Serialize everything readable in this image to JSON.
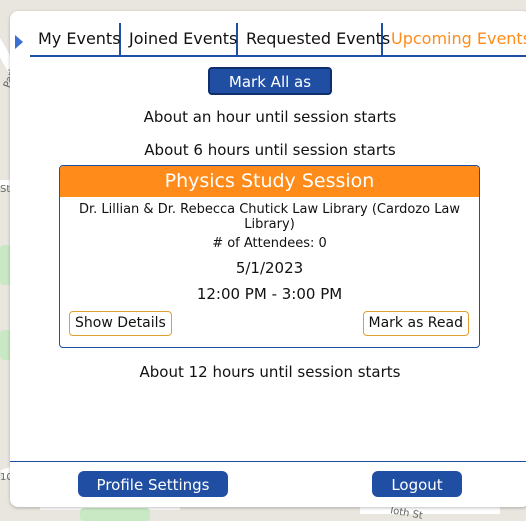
{
  "tabs": [
    {
      "label": "My Events"
    },
    {
      "label": "Joined Events"
    },
    {
      "label": "Requested Events"
    },
    {
      "label": "Upcoming Events"
    }
  ],
  "mark_all_label": "Mark All as Read",
  "notices": [
    "About an hour until session starts",
    "About 6 hours until session starts",
    "About 12 hours until session starts"
  ],
  "event_card": {
    "title": "Physics Study Session",
    "location": "Dr. Lillian & Dr. Rebecca Chutick Law Library (Cardozo Law Library)",
    "attendees": "# of Attendees: 0",
    "date": "5/1/2023",
    "time": "12:00 PM - 3:00 PM",
    "details_label": "Show Details",
    "mark_read_label": "Mark as Read"
  },
  "footer": {
    "profile_label": "Profile Settings",
    "logout_label": "Logout"
  },
  "map_labels": [
    "Park",
    "St",
    "10",
    "Ioth St"
  ],
  "colors": {
    "accent_blue": "#1f4ea3",
    "accent_orange": "#ff8c1a"
  }
}
